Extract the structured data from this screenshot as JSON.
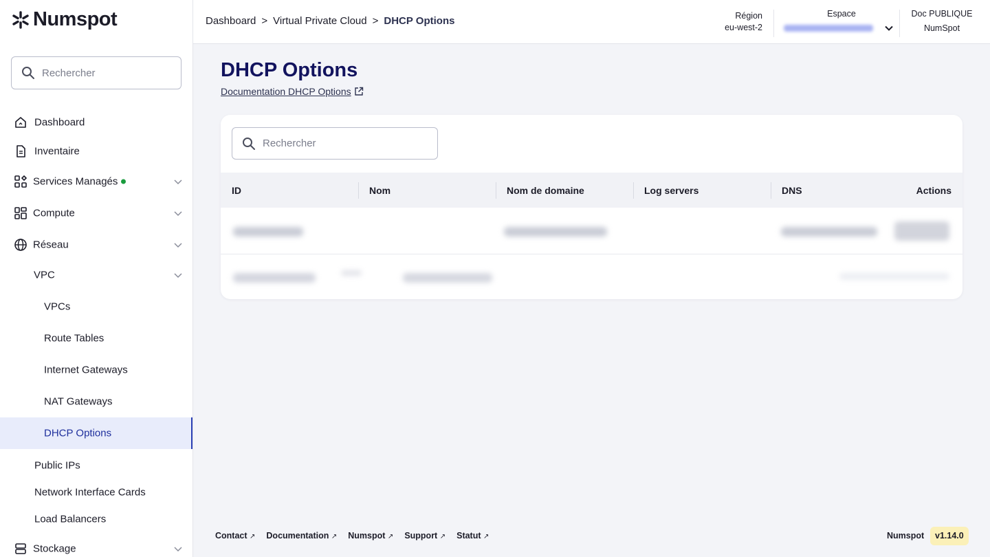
{
  "app": {
    "brand": "Numspot"
  },
  "sidebar": {
    "search_placeholder": "Rechercher",
    "items": [
      {
        "label": "Dashboard"
      },
      {
        "label": "Inventaire"
      },
      {
        "label": "Services Managés"
      },
      {
        "label": "Compute"
      },
      {
        "label": "Réseau"
      },
      {
        "label": "VPC"
      },
      {
        "label": "VPCs"
      },
      {
        "label": "Route Tables"
      },
      {
        "label": "Internet Gateways"
      },
      {
        "label": "NAT Gateways"
      },
      {
        "label": "DHCP Options"
      },
      {
        "label": "Public IPs"
      },
      {
        "label": "Network Interface Cards"
      },
      {
        "label": "Load Balancers"
      },
      {
        "label": "Stockage"
      }
    ]
  },
  "topbar": {
    "breadcrumb": [
      "Dashboard",
      "Virtual Private Cloud",
      "DHCP Options"
    ],
    "breadcrumb_sep": ">",
    "region_label": "Région",
    "region_value": "eu-west-2",
    "espace_label": "Espace",
    "doc_label": "Doc PUBLIQUE",
    "doc_value": "NumSpot"
  },
  "main": {
    "title": "DHCP Options",
    "doc_link": "Documentation DHCP Options",
    "search_placeholder": "Rechercher",
    "columns": [
      "ID",
      "Nom",
      "Nom de domaine",
      "Log servers",
      "DNS",
      "Actions"
    ]
  },
  "footer": {
    "links": [
      "Contact",
      "Documentation",
      "Numspot",
      "Support",
      "Statut"
    ],
    "brand": "Numspot",
    "version": "v1.14.0"
  },
  "colors": {
    "accent": "#2a3fb4",
    "title": "#12135e",
    "version_badge": "#fbf0b8",
    "status_dot": "#1a9c3e"
  }
}
